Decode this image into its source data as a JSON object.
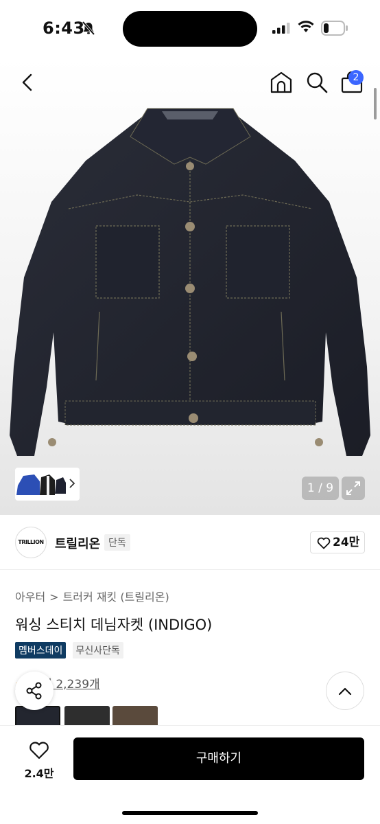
{
  "status_bar": {
    "time": "6:43"
  },
  "nav": {
    "cart_count": "2"
  },
  "gallery": {
    "current": "1",
    "separator": "/",
    "total": "9"
  },
  "brand": {
    "logo_text": "TRILLION",
    "name": "트릴리온",
    "exclusive_badge": "단독",
    "like_count": "24만"
  },
  "breadcrumb": {
    "category": "아우터",
    "separator": ">",
    "subcategory": "트러커 재킷 (트릴리온)"
  },
  "product": {
    "title": "워싱 스티치 데님자켓 (INDIGO)"
  },
  "tags": [
    {
      "label": "멤버스데이"
    },
    {
      "label": "무신사단독"
    }
  ],
  "reviews": {
    "star": "★",
    "text": "후기 2,239개"
  },
  "bottom_bar": {
    "favorite_count": "2.4만",
    "buy_label": "구매하기"
  },
  "colors": {
    "accent_blue": "#3b66ff",
    "tag_navy": "#0f3b62",
    "buy_black": "#000000",
    "star": "#f5a623"
  }
}
